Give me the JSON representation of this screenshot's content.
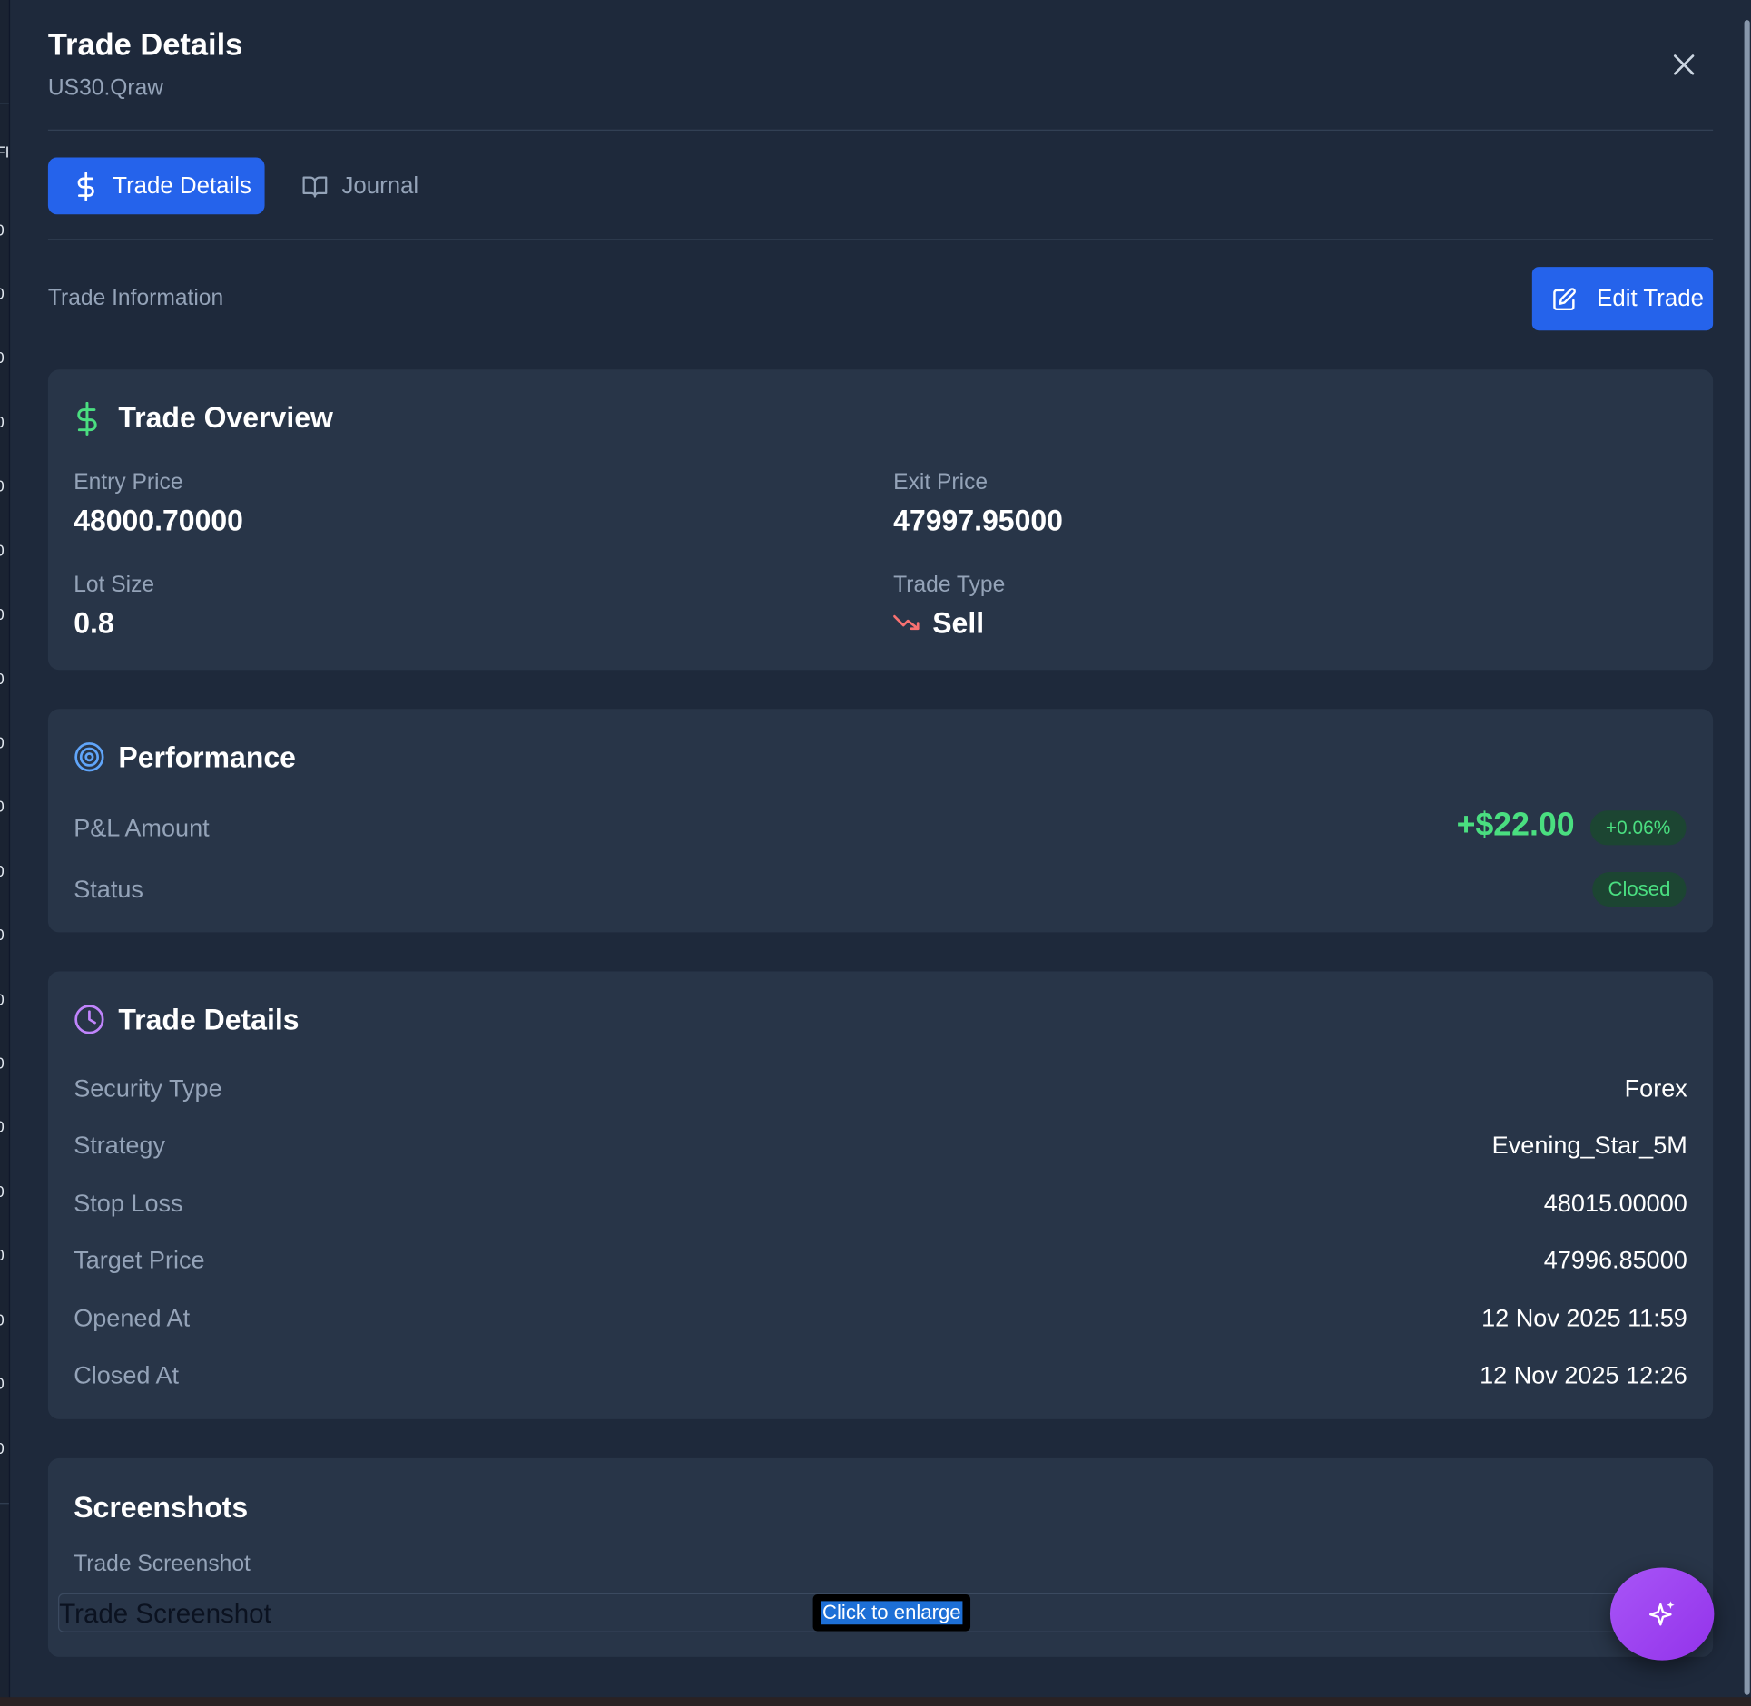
{
  "modal": {
    "title": "Trade Details",
    "subtitle": "US30.Qraw"
  },
  "tabs": [
    {
      "label": "Trade Details",
      "icon": "dollar-icon",
      "active": true
    },
    {
      "label": "Journal",
      "icon": "book-open-icon",
      "active": false
    }
  ],
  "section": {
    "label": "Trade Information",
    "edit_label": "Edit Trade"
  },
  "overview": {
    "title": "Trade Overview",
    "entry_label": "Entry Price",
    "entry_value": "48000.70000",
    "exit_label": "Exit Price",
    "exit_value": "47997.95000",
    "lot_label": "Lot Size",
    "lot_value": "0.8",
    "type_label": "Trade Type",
    "type_value": "Sell"
  },
  "performance": {
    "title": "Performance",
    "pnl_label": "P&L Amount",
    "pnl_value": "+$22.00",
    "pnl_pct": "+0.06%",
    "status_label": "Status",
    "status_value": "Closed"
  },
  "details": {
    "title": "Trade Details",
    "rows": [
      {
        "label": "Security Type",
        "value": "Forex"
      },
      {
        "label": "Strategy",
        "value": "Evening_Star_5M"
      },
      {
        "label": "Stop Loss",
        "value": "48015.00000"
      },
      {
        "label": "Target Price",
        "value": "47996.85000"
      },
      {
        "label": "Opened At",
        "value": "12 Nov 2025 11:59"
      },
      {
        "label": "Closed At",
        "value": "12 Nov 2025 12:26"
      }
    ]
  },
  "screenshots": {
    "title": "Screenshots",
    "item_label": "Trade Screenshot",
    "image_alt": "Trade Screenshot",
    "enlarge_label": "Click to enlarge"
  },
  "colors": {
    "background": "#1e293b",
    "card": "#283548",
    "accent": "#2563eb",
    "positive": "#4ade80",
    "negative": "#f87171",
    "purple": "#a855f7"
  }
}
